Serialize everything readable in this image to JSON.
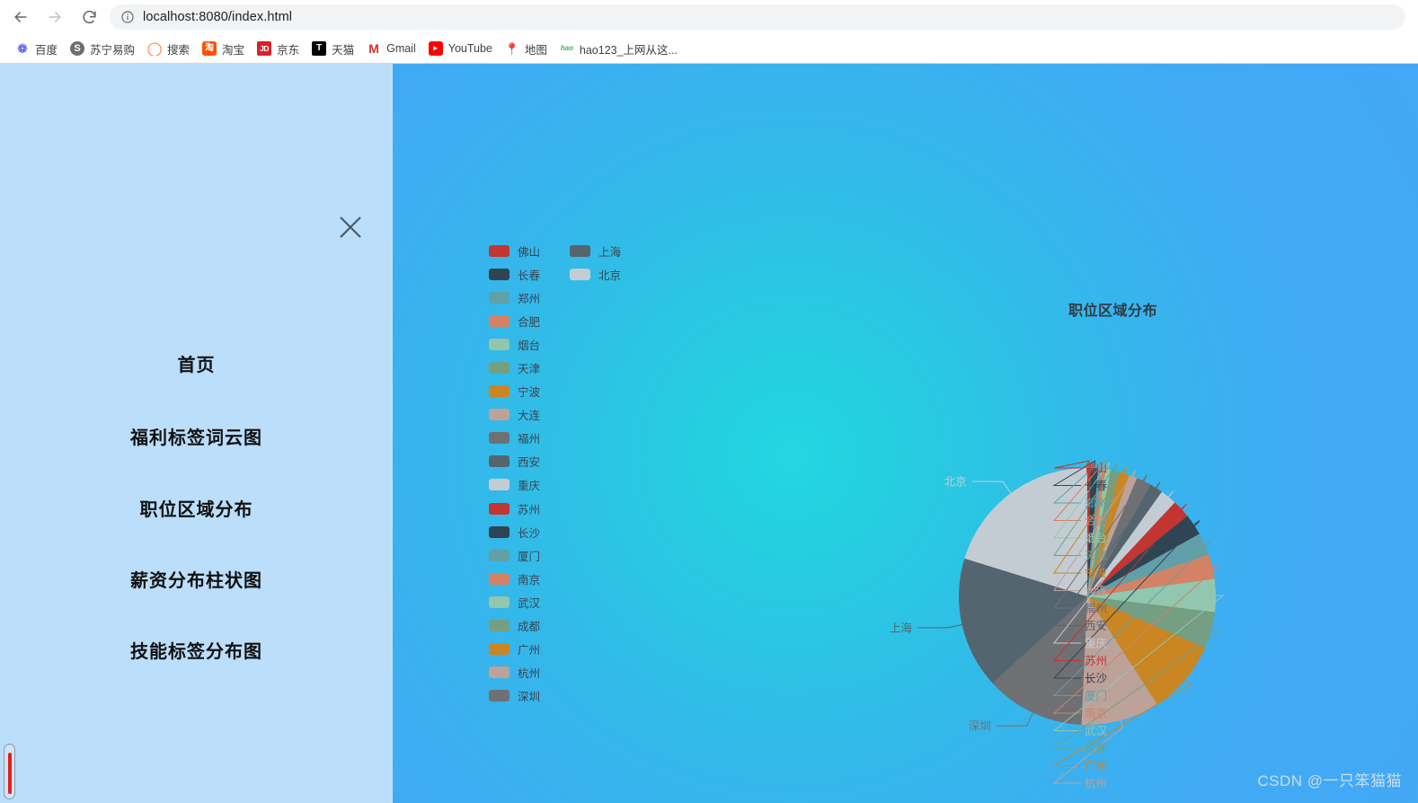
{
  "browser": {
    "back_label": "back-arrow",
    "forward_label": "forward-arrow",
    "reload_label": "reload",
    "url": "localhost:8080/index.html",
    "url_host": "localhost:8080",
    "url_path": "/index.html",
    "site_info_icon": "info-circle-icon",
    "bookmarks": [
      {
        "label": "百度",
        "icon": "baidu-icon",
        "glyph": "❁",
        "cls": "ic-baidu"
      },
      {
        "label": "苏宁易购",
        "icon": "suning-icon",
        "glyph": "S",
        "cls": "ic-suning"
      },
      {
        "label": "搜索",
        "icon": "sogou-icon",
        "glyph": "◯",
        "cls": "ic-sogou"
      },
      {
        "label": "淘宝",
        "icon": "taobao-icon",
        "glyph": "淘",
        "cls": "ic-taobao"
      },
      {
        "label": "京东",
        "icon": "jd-icon",
        "glyph": "JD",
        "cls": "ic-jd"
      },
      {
        "label": "天猫",
        "icon": "tmall-icon",
        "glyph": "T",
        "cls": "ic-tmall"
      },
      {
        "label": "Gmail",
        "icon": "gmail-icon",
        "glyph": "M",
        "cls": "ic-gmail"
      },
      {
        "label": "YouTube",
        "icon": "youtube-icon",
        "glyph": "▶",
        "cls": "ic-youtube"
      },
      {
        "label": "地图",
        "icon": "map-icon",
        "glyph": "📍",
        "cls": "ic-map"
      },
      {
        "label": "hao123_上网从这...",
        "icon": "hao123-icon",
        "glyph": "hao",
        "cls": "ic-hao"
      }
    ]
  },
  "drawer": {
    "close_icon": "close-x-icon",
    "background_color": "#bbdefb",
    "menu": [
      {
        "label": "首页"
      },
      {
        "label": "福利标签词云图"
      },
      {
        "label": "职位区域分布"
      },
      {
        "label": "薪资分布柱状图"
      },
      {
        "label": "技能标签分布图"
      }
    ],
    "scrollbar": {
      "thumb_color": "#e02020"
    }
  },
  "stage": {
    "watermark": "CSDN @一只笨猫猫",
    "gradient_center": "#24d6e2",
    "gradient_edge": "#43a8f6"
  },
  "chart_data": {
    "type": "pie",
    "title": "职位区域分布",
    "xlabel": "",
    "ylabel": "",
    "legend_position": "left",
    "center": [
      1210,
      593
    ],
    "radius": 143,
    "labels": [
      "佛山",
      "长春",
      "郑州",
      "合肥",
      "烟台",
      "天津",
      "宁波",
      "大连",
      "福州",
      "西安",
      "重庆",
      "苏州",
      "长沙",
      "厦门",
      "南京",
      "武汉",
      "成都",
      "广州",
      "杭州",
      "深圳",
      "上海",
      "北京"
    ],
    "values": [
      0.4,
      0.9,
      0.4,
      0.5,
      0.6,
      1.1,
      1.2,
      1.0,
      1.8,
      1.6,
      2.0,
      2.2,
      2.6,
      2.7,
      3.0,
      4.0,
      4.4,
      9.0,
      9.5,
      12.0,
      16.0,
      19.5
    ],
    "colors": [
      "#c23531",
      "#2f4554",
      "#61a0a8",
      "#d48265",
      "#91c7ae",
      "#749f83",
      "#ca8622",
      "#bda29a",
      "#6e7074",
      "#546570",
      "#c4ccd3",
      "#c23531",
      "#2f4554",
      "#61a0a8",
      "#d48265",
      "#91c7ae",
      "#749f83",
      "#ca8622",
      "#bda29a",
      "#6e7074",
      "#546570",
      "#c4ccd3"
    ],
    "legend_column_a": [
      "佛山",
      "长春",
      "郑州",
      "合肥",
      "烟台",
      "天津",
      "宁波",
      "大连",
      "福州",
      "西安",
      "重庆",
      "苏州",
      "长沙",
      "厦门",
      "南京",
      "武汉",
      "成都",
      "广州",
      "杭州",
      "深圳"
    ],
    "legend_column_b": [
      "上海",
      "北京"
    ]
  }
}
